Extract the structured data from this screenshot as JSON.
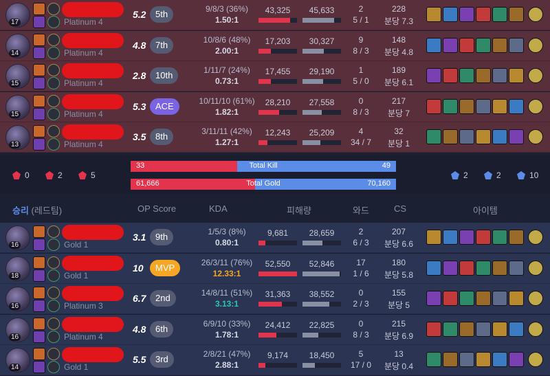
{
  "header": {
    "result": "승리",
    "team": "(레드팀)",
    "op_score": "OP Score",
    "kda": "KDA",
    "damage": "피해량",
    "ward": "와드",
    "cs": "CS",
    "items": "아이템"
  },
  "summary": {
    "red_objectives": [
      {
        "icon": "baron-icon",
        "value": "0"
      },
      {
        "icon": "dragon-icon",
        "value": "2"
      },
      {
        "icon": "tower-icon",
        "value": "5"
      }
    ],
    "blue_objectives": [
      {
        "icon": "baron-icon",
        "value": "2"
      },
      {
        "icon": "dragon-icon",
        "value": "2"
      },
      {
        "icon": "tower-icon",
        "value": "10"
      }
    ],
    "kill": {
      "label": "Total Kill",
      "red": "33",
      "blue": "49",
      "red_fraction": 0.4024
    },
    "gold": {
      "label": "Total Gold",
      "red": "61,666",
      "blue": "70,160",
      "red_fraction": 0.4678
    }
  },
  "losing_team": [
    {
      "level": "17",
      "tier": "Platinum 4",
      "op": "5.2",
      "rank": "5th",
      "rank_style": "normal",
      "kda_line": "9/8/3 (36%)",
      "kda_ratio": "1.50:1",
      "kda_style": "normal",
      "dealt": "43,325",
      "taken": "45,633",
      "dealt_frac": 0.82,
      "taken_frac": 0.83,
      "ward1": "2",
      "ward2": "5 / 1",
      "cs1": "228",
      "cs2": "분당 7.3"
    },
    {
      "level": "14",
      "tier": "Platinum 4",
      "op": "4.8",
      "rank": "7th",
      "rank_style": "normal",
      "kda_line": "10/8/6 (48%)",
      "kda_ratio": "2.00:1",
      "kda_style": "normal",
      "dealt": "17,203",
      "taken": "30,327",
      "dealt_frac": 0.33,
      "taken_frac": 0.55,
      "ward1": "9",
      "ward2": "8 / 3",
      "cs1": "148",
      "cs2": "분당 4.8"
    },
    {
      "level": "15",
      "tier": "Platinum 4",
      "op": "2.8",
      "rank": "10th",
      "rank_style": "normal",
      "kda_line": "1/11/7 (24%)",
      "kda_ratio": "0.73:1",
      "kda_style": "normal",
      "dealt": "17,455",
      "taken": "29,190",
      "dealt_frac": 0.33,
      "taken_frac": 0.53,
      "ward1": "1",
      "ward2": "5 / 0",
      "cs1": "189",
      "cs2": "분당 6.1"
    },
    {
      "level": "15",
      "tier": "Platinum 4",
      "op": "5.3",
      "rank": "ACE",
      "rank_style": "ace",
      "kda_line": "10/11/10 (61%)",
      "kda_ratio": "1.82:1",
      "kda_style": "normal",
      "dealt": "28,210",
      "taken": "27,558",
      "dealt_frac": 0.54,
      "taken_frac": 0.5,
      "ward1": "0",
      "ward2": "8 / 3",
      "cs1": "217",
      "cs2": "분당 7"
    },
    {
      "level": "13",
      "tier": "Platinum 4",
      "op": "3.5",
      "rank": "8th",
      "rank_style": "normal",
      "kda_line": "3/11/11 (42%)",
      "kda_ratio": "1.27:1",
      "kda_style": "normal",
      "dealt": "12,243",
      "taken": "25,209",
      "dealt_frac": 0.23,
      "taken_frac": 0.46,
      "ward1": "4",
      "ward2": "34 / 7",
      "cs1": "32",
      "cs2": "분당 1"
    }
  ],
  "winning_team": [
    {
      "level": "16",
      "tier": "Gold 1",
      "op": "3.1",
      "rank": "9th",
      "rank_style": "normal",
      "kda_line": "1/5/3 (8%)",
      "kda_ratio": "0.80:1",
      "kda_style": "normal",
      "dealt": "9,681",
      "taken": "28,659",
      "dealt_frac": 0.18,
      "taken_frac": 0.52,
      "ward1": "2",
      "ward2": "6 / 3",
      "cs1": "207",
      "cs2": "분당 6.6"
    },
    {
      "level": "18",
      "tier": "Gold 1",
      "op": "10",
      "rank": "MVP",
      "rank_style": "mvp",
      "kda_line": "26/3/11 (76%)",
      "kda_ratio": "12.33:1",
      "kda_style": "gold",
      "dealt": "52,550",
      "taken": "52,846",
      "dealt_frac": 1.0,
      "taken_frac": 0.96,
      "ward1": "17",
      "ward2": "1 / 6",
      "cs1": "180",
      "cs2": "분당 5.8"
    },
    {
      "level": "16",
      "tier": "Platinum 3",
      "op": "6.7",
      "rank": "2nd",
      "rank_style": "normal",
      "kda_line": "14/8/11 (51%)",
      "kda_ratio": "3.13:1",
      "kda_style": "teal",
      "dealt": "31,363",
      "taken": "38,552",
      "dealt_frac": 0.6,
      "taken_frac": 0.7,
      "ward1": "0",
      "ward2": "2 / 3",
      "cs1": "155",
      "cs2": "분당 5"
    },
    {
      "level": "16",
      "tier": "Platinum 4",
      "op": "4.8",
      "rank": "6th",
      "rank_style": "normal",
      "kda_line": "6/9/10 (33%)",
      "kda_ratio": "1.78:1",
      "kda_style": "normal",
      "dealt": "24,412",
      "taken": "22,825",
      "dealt_frac": 0.46,
      "taken_frac": 0.41,
      "ward1": "0",
      "ward2": "8 / 3",
      "cs1": "215",
      "cs2": "분당 6.9"
    },
    {
      "level": "14",
      "tier": "Gold 1",
      "op": "5.5",
      "rank": "3rd",
      "rank_style": "normal",
      "kda_line": "2/8/21 (47%)",
      "kda_ratio": "2.88:1",
      "kda_style": "normal",
      "dealt": "9,174",
      "taken": "18,450",
      "dealt_frac": 0.17,
      "taken_frac": 0.33,
      "ward1": "5",
      "ward2": "17 / 0",
      "cs1": "13",
      "cs2": "분당 0.4"
    }
  ],
  "colors": {
    "lose_bg": "#5a2f3c",
    "win_bg": "#2b3453",
    "red": "#e3344d",
    "blue": "#5b8ce8",
    "ace": "#7a64e3",
    "mvp": "#f5a623"
  }
}
